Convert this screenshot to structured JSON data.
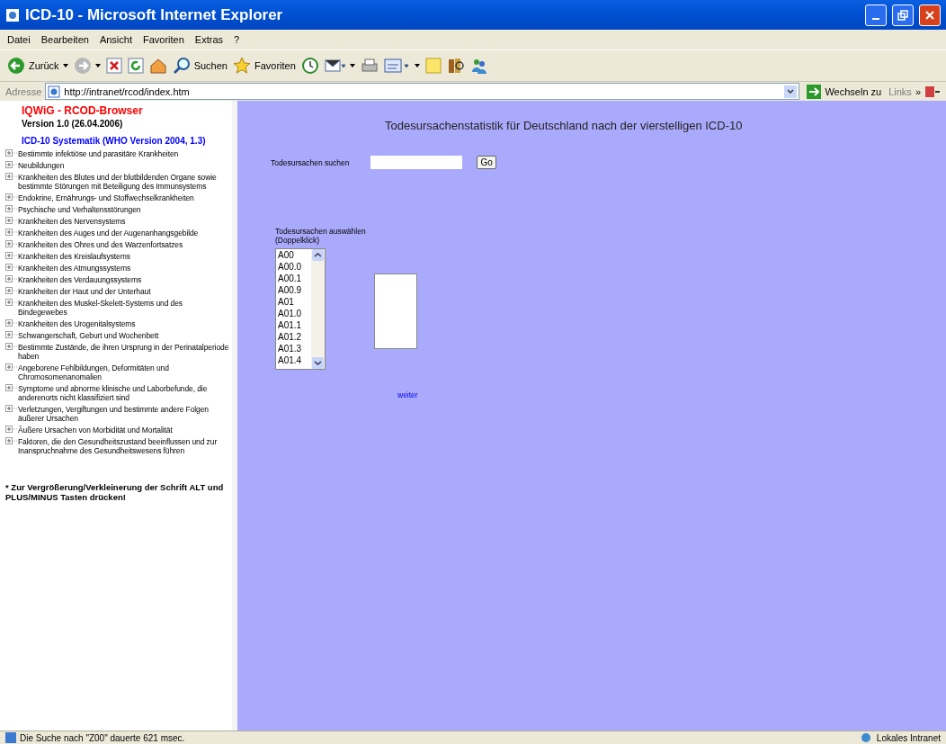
{
  "window": {
    "title": "ICD-10 - Microsoft Internet Explorer"
  },
  "menu": [
    "Datei",
    "Bearbeiten",
    "Ansicht",
    "Favoriten",
    "Extras",
    "?"
  ],
  "toolbar": [
    {
      "kind": "back",
      "label": "Zurück"
    },
    {
      "kind": "forward"
    },
    {
      "kind": "stop"
    },
    {
      "kind": "refresh"
    },
    {
      "kind": "home"
    },
    {
      "kind": "search",
      "label": "Suchen"
    },
    {
      "kind": "favorites",
      "label": "Favoriten"
    },
    {
      "kind": "history"
    },
    {
      "kind": "mail"
    },
    {
      "kind": "print"
    },
    {
      "kind": "edit"
    },
    {
      "kind": "note"
    },
    {
      "kind": "research"
    },
    {
      "kind": "messenger"
    }
  ],
  "address_bar": {
    "label": "Adresse",
    "value": "http://intranet/rcod/index.htm",
    "go": "Wechseln zu",
    "links": "Links",
    "more": "»"
  },
  "sidebar": {
    "title": "IQWiG - RCOD-Browser",
    "version": "Version 1.0 (26.04.2006)",
    "subtitle": "ICD-10 Systematik (WHO Version 2004, 1.3)",
    "items": [
      {
        "label": "Bestimmte infektiöse und parasitäre Krankheiten",
        "expanded": false
      },
      {
        "label": "Neubildungen",
        "expanded": false
      },
      {
        "label": "Krankheiten des Blutes und der blutbildenden Organe sowie bestimmte Störungen mit Beteiligung des Immunsystems",
        "expanded": false
      },
      {
        "label": "Endokrine, Ernährungs- und Stoffwechselkrankheiten",
        "expanded": false
      },
      {
        "label": "Psychische und Verhaltensstörungen",
        "expanded": false
      },
      {
        "label": "Krankheiten des Nervensystems",
        "expanded": false
      },
      {
        "label": "Krankheiten des Auges und der Augenanhangsgebilde",
        "expanded": false
      },
      {
        "label": "Krankheiten des Ohres und des Warzenfortsatzes",
        "expanded": false
      },
      {
        "label": "Krankheiten des Kreislaufsystems",
        "expanded": false
      },
      {
        "label": "Krankheiten des Atmungssystems",
        "expanded": false
      },
      {
        "label": "Krankheiten des Verdauungssystems",
        "expanded": false
      },
      {
        "label": "Krankheiten der Haut und der Unterhaut",
        "expanded": false
      },
      {
        "label": "Krankheiten des Muskel-Skelett-Systems und des Bindegewebes",
        "expanded": false
      },
      {
        "label": "Krankheiten des Urogenitalsystems",
        "expanded": false
      },
      {
        "label": "Schwangerschaft, Geburt und Wochenbett",
        "expanded": false
      },
      {
        "label": "Bestimmte Zustände, die ihren Ursprung in der Perinatalperiode haben",
        "expanded": false
      },
      {
        "label": "Angeborene Fehlbildungen, Deformitäten und Chromosomenanomalien",
        "expanded": false
      },
      {
        "label": "Symptome und abnorme klinische und Laborbefunde, die anderenorts nicht klassifiziert sind",
        "expanded": false
      },
      {
        "label": "Verletzungen, Vergiftungen und bestimmte andere Folgen äußerer Ursachen",
        "expanded": false
      },
      {
        "label": "Äußere Ursachen von Morbidität und Mortalität",
        "expanded": false
      },
      {
        "label": "Faktoren, die den Gesundheitszustand beeinflussen und zur Inanspruchnahme des Gesundheitswesens führen",
        "expanded": false
      }
    ],
    "note": "* Zur Vergrößerung/Verkleinerung der Schrift ALT und PLUS/MINUS Tasten drücken!"
  },
  "main": {
    "heading": "Todesursachenstatistik für Deutschland nach der vierstelligen ICD-10",
    "search": {
      "label": "Todesursachen suchen",
      "button": "Go"
    },
    "select_label": "Todesursachen auswählen (Doppelklick)",
    "codes": [
      "A00",
      "A00.0",
      "A00.1",
      "A00.9",
      "A01",
      "A01.0",
      "A01.1",
      "A01.2",
      "A01.3",
      "A01.4"
    ],
    "next_link": "weiter"
  },
  "status_bar": {
    "text": "Die Suche nach \"Z00\" dauerte 621 msec.",
    "zone": "Lokales Intranet"
  }
}
